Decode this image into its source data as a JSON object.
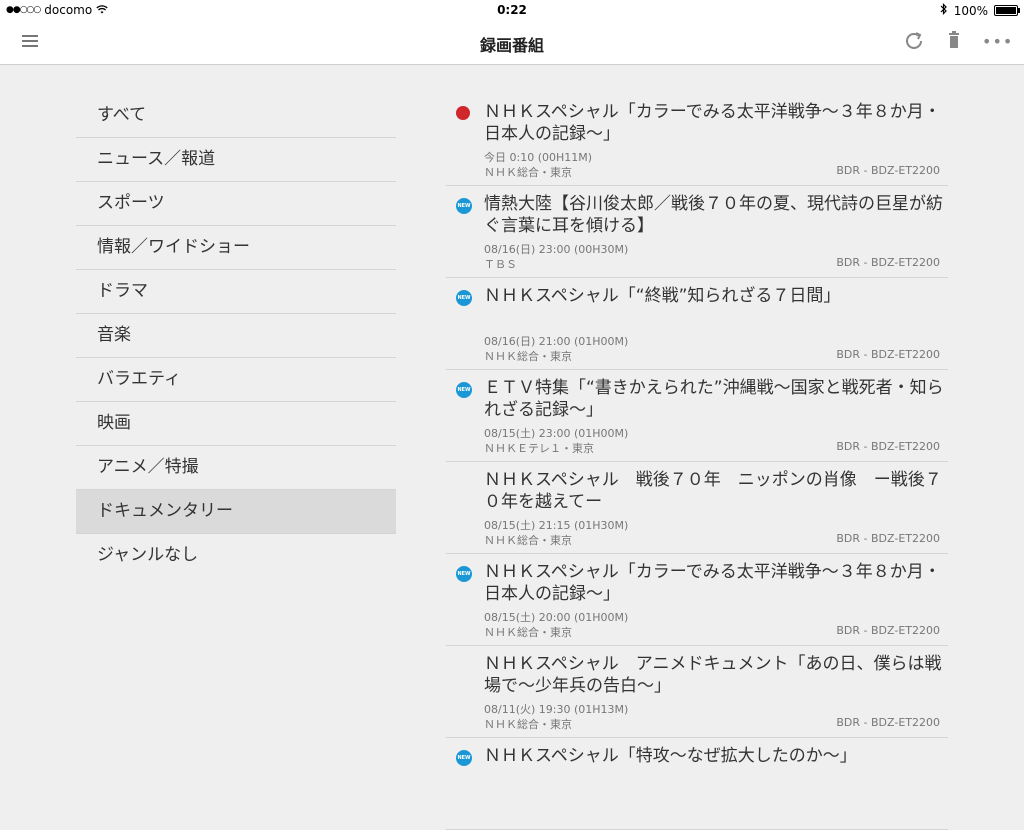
{
  "status_bar": {
    "carrier": "docomo",
    "time": "0:22",
    "battery": "100%",
    "signal_dots": "●●○○○"
  },
  "nav": {
    "title": "録画番組"
  },
  "genres": [
    {
      "label": "すべて",
      "selected": false
    },
    {
      "label": "ニュース／報道",
      "selected": false
    },
    {
      "label": "スポーツ",
      "selected": false
    },
    {
      "label": "情報／ワイドショー",
      "selected": false
    },
    {
      "label": "ドラマ",
      "selected": false
    },
    {
      "label": "音楽",
      "selected": false
    },
    {
      "label": "バラエティ",
      "selected": false
    },
    {
      "label": "映画",
      "selected": false
    },
    {
      "label": "アニメ／特撮",
      "selected": false
    },
    {
      "label": "ドキュメンタリー",
      "selected": true
    },
    {
      "label": "ジャンルなし",
      "selected": false
    }
  ],
  "programs": [
    {
      "mark": "recording",
      "title": "ＮＨＫスペシャル「カラーでみる太平洋戦争〜３年８か月・日本人の記録〜」",
      "date": "今日 0:10 (00H11M)",
      "channel": "ＮＨＫ総合・東京",
      "device": "BDR - BDZ-ET2200"
    },
    {
      "mark": "new",
      "title": "情熱大陸【谷川俊太郎／戦後７０年の夏、現代詩の巨星が紡ぐ言葉に耳を傾ける】",
      "date": "08/16(日) 23:00 (00H30M)",
      "channel": "ＴＢＳ",
      "device": "BDR - BDZ-ET2200"
    },
    {
      "mark": "new",
      "title": "ＮＨＫスペシャル「“終戦”知られざる７日間」",
      "date": "08/16(日) 21:00 (01H00M)",
      "channel": "ＮＨＫ総合・東京",
      "device": "BDR - BDZ-ET2200"
    },
    {
      "mark": "new",
      "title": "ＥＴＶ特集「“書きかえられた”沖縄戦〜国家と戦死者・知られざる記録〜」",
      "date": "08/15(土) 23:00 (01H00M)",
      "channel": "ＮＨＫＥテレ１・東京",
      "device": "BDR - BDZ-ET2200"
    },
    {
      "mark": "none",
      "title": "ＮＨＫスペシャル　戦後７０年　ニッポンの肖像　ー戦後７０年を越えてー",
      "date": "08/15(土) 21:15 (01H30M)",
      "channel": "ＮＨＫ総合・東京",
      "device": "BDR - BDZ-ET2200"
    },
    {
      "mark": "new",
      "title": "ＮＨＫスペシャル「カラーでみる太平洋戦争〜３年８か月・日本人の記録〜」",
      "date": "08/15(土) 20:00 (01H00M)",
      "channel": "ＮＨＫ総合・東京",
      "device": "BDR - BDZ-ET2200"
    },
    {
      "mark": "none",
      "title": "ＮＨＫスペシャル　アニメドキュメント「あの日、僕らは戦場で〜少年兵の告白〜」",
      "date": "08/11(火) 19:30 (01H13M)",
      "channel": "ＮＨＫ総合・東京",
      "device": "BDR - BDZ-ET2200"
    },
    {
      "mark": "new",
      "title": "ＮＨＫスペシャル「特攻〜なぜ拡大したのか〜」",
      "date": "",
      "channel": "",
      "device": ""
    }
  ],
  "new_badge_text": "NEW",
  "colors": {
    "recording_dot": "#d0262c",
    "new_badge": "#1a97d6",
    "selected_genre_bg": "#dadada"
  },
  "icons": {
    "menu": "hamburger-icon",
    "refresh": "refresh-icon",
    "delete": "trash-icon",
    "more": "more-icon"
  }
}
